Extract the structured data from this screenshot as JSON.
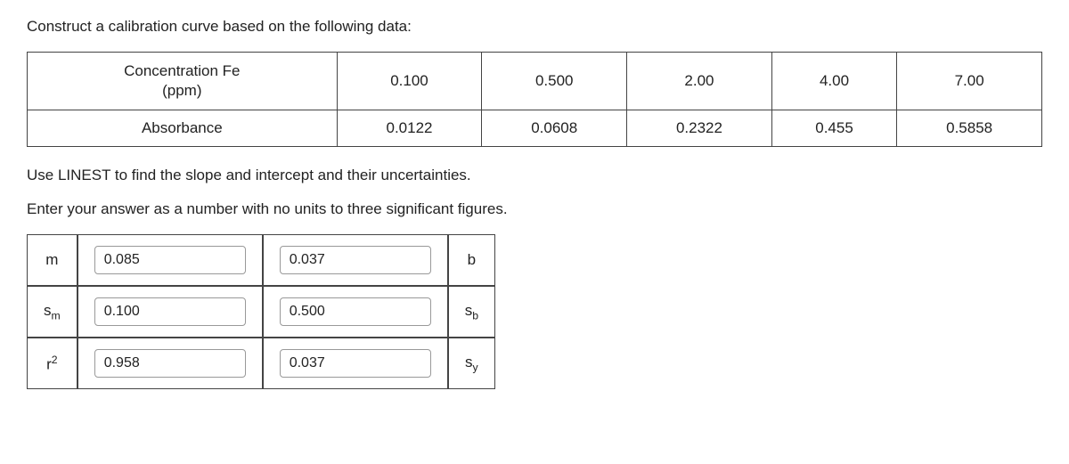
{
  "intro": "Construct a calibration curve based on the following data:",
  "data_table": {
    "rows": [
      {
        "header": "Concentration Fe\n(ppm)",
        "values": [
          "0.100",
          "0.500",
          "2.00",
          "4.00",
          "7.00"
        ]
      },
      {
        "header": "Absorbance",
        "values": [
          "0.0122",
          "0.0608",
          "0.2322",
          "0.455",
          "0.5858"
        ]
      }
    ]
  },
  "instruction1": "Use LINEST to find the slope and intercept and their uncertainties.",
  "instruction2": "Enter your answer as a number with no units to three significant figures.",
  "answers": {
    "rows": [
      {
        "label_left": "m",
        "value_left": "0.085",
        "value_right": "0.037",
        "label_right": "b"
      },
      {
        "label_left": "s_m",
        "value_left": "0.100",
        "value_right": "0.500",
        "label_right": "s_b"
      },
      {
        "label_left": "r2",
        "value_left": "0.958",
        "value_right": "0.037",
        "label_right": "s_y"
      }
    ]
  }
}
